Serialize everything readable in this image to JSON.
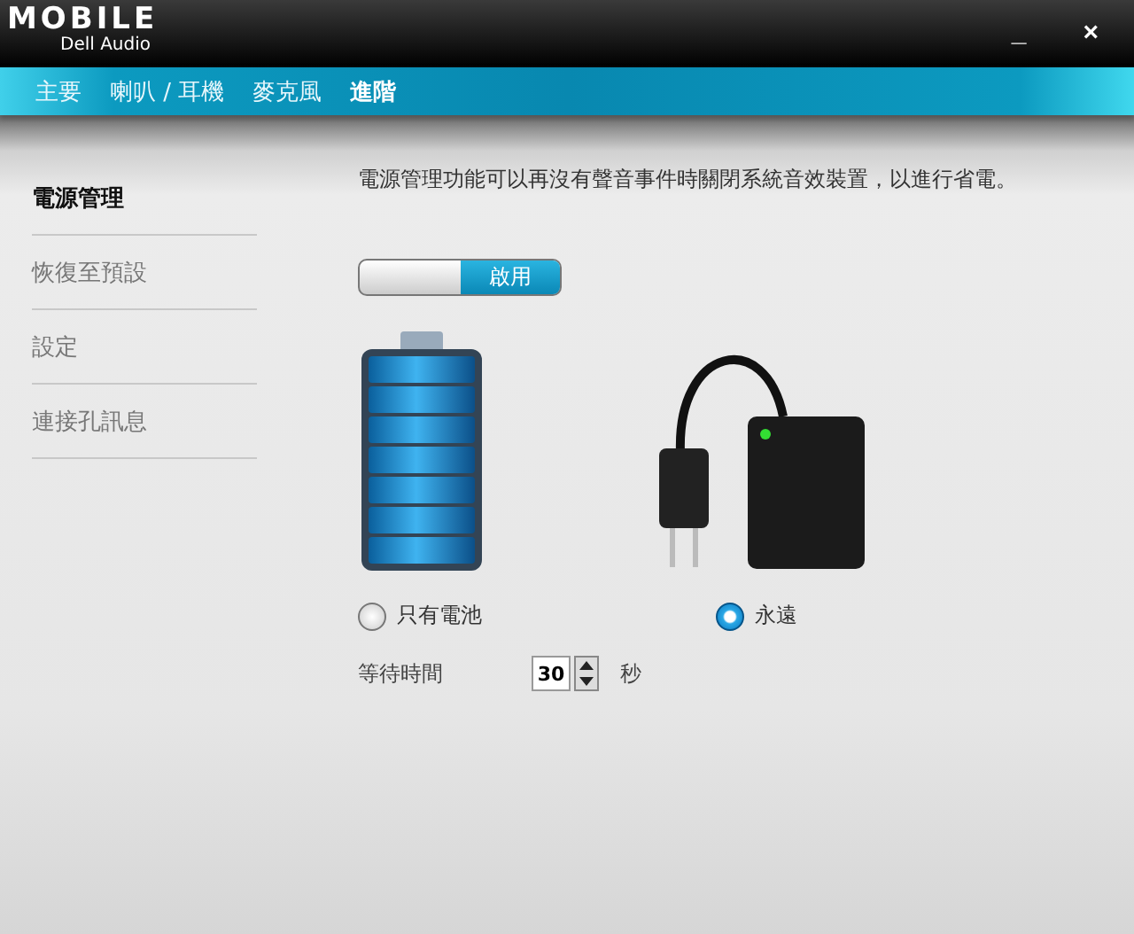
{
  "window": {
    "logo": "MOBILE",
    "subtitle": "Dell Audio",
    "controls": [
      "_",
      "×"
    ]
  },
  "tabs": [
    {
      "label": "主要",
      "selected": false
    },
    {
      "label": "喇叭 / 耳機",
      "selected": false
    },
    {
      "label": "麥克風",
      "selected": false
    },
    {
      "label": "進階",
      "selected": true
    }
  ],
  "sidebar": {
    "items": [
      {
        "label": "電源管理",
        "selected": true
      },
      {
        "label": "恢復至預設",
        "selected": false
      },
      {
        "label": "設定",
        "selected": false
      },
      {
        "label": "連接孔訊息",
        "selected": false
      }
    ]
  },
  "description": "電源管理功能可以再沒有聲音事件時關閉系統音效裝置，以進行省電。",
  "toggle": {
    "label": "啟用",
    "on": true
  },
  "power_options": [
    {
      "kind": "battery",
      "label": "只有電池",
      "selected": false
    },
    {
      "kind": "adapter",
      "label": "永遠",
      "selected": true
    }
  ],
  "wait_time": {
    "label": "等待時間",
    "value": "30",
    "unit": "秒"
  }
}
